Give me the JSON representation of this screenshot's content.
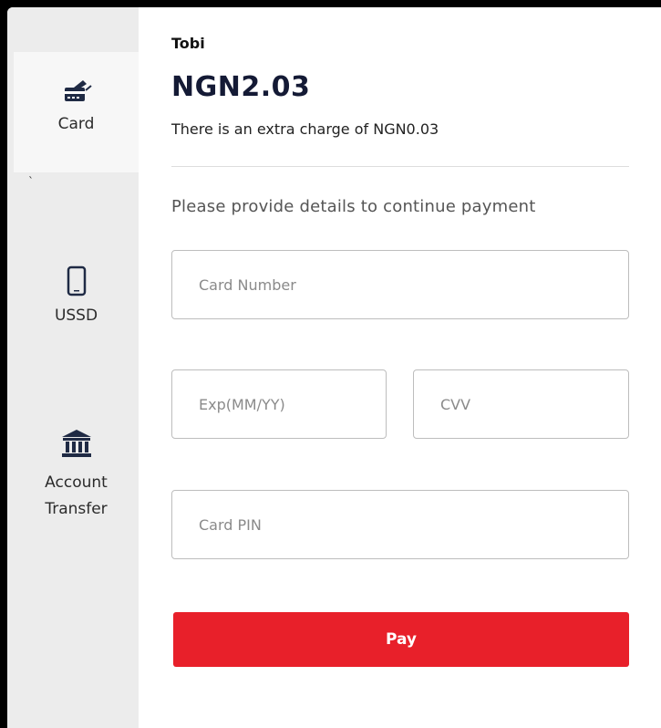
{
  "sidebar": {
    "items": [
      {
        "label": "Card",
        "icon": "credit-card-icon",
        "active": true
      },
      {
        "label": "USSD",
        "icon": "phone-icon",
        "active": false
      },
      {
        "label": "Account",
        "label2": "Transfer",
        "icon": "bank-icon",
        "active": false
      }
    ],
    "tick": "`"
  },
  "payment": {
    "merchant": "Tobi",
    "amount": "NGN2.03",
    "charge_note": "There is an extra charge of NGN0.03",
    "instructions": "Please provide details to continue payment"
  },
  "form": {
    "card_number_placeholder": "Card Number",
    "expiry_placeholder": "Exp(MM/YY)",
    "cvv_placeholder": "CVV",
    "pin_placeholder": "Card PIN",
    "pay_label": "Pay"
  },
  "colors": {
    "accent": "#e8202a",
    "icon": "#1f2a44",
    "sidebar_bg": "#ececec"
  }
}
